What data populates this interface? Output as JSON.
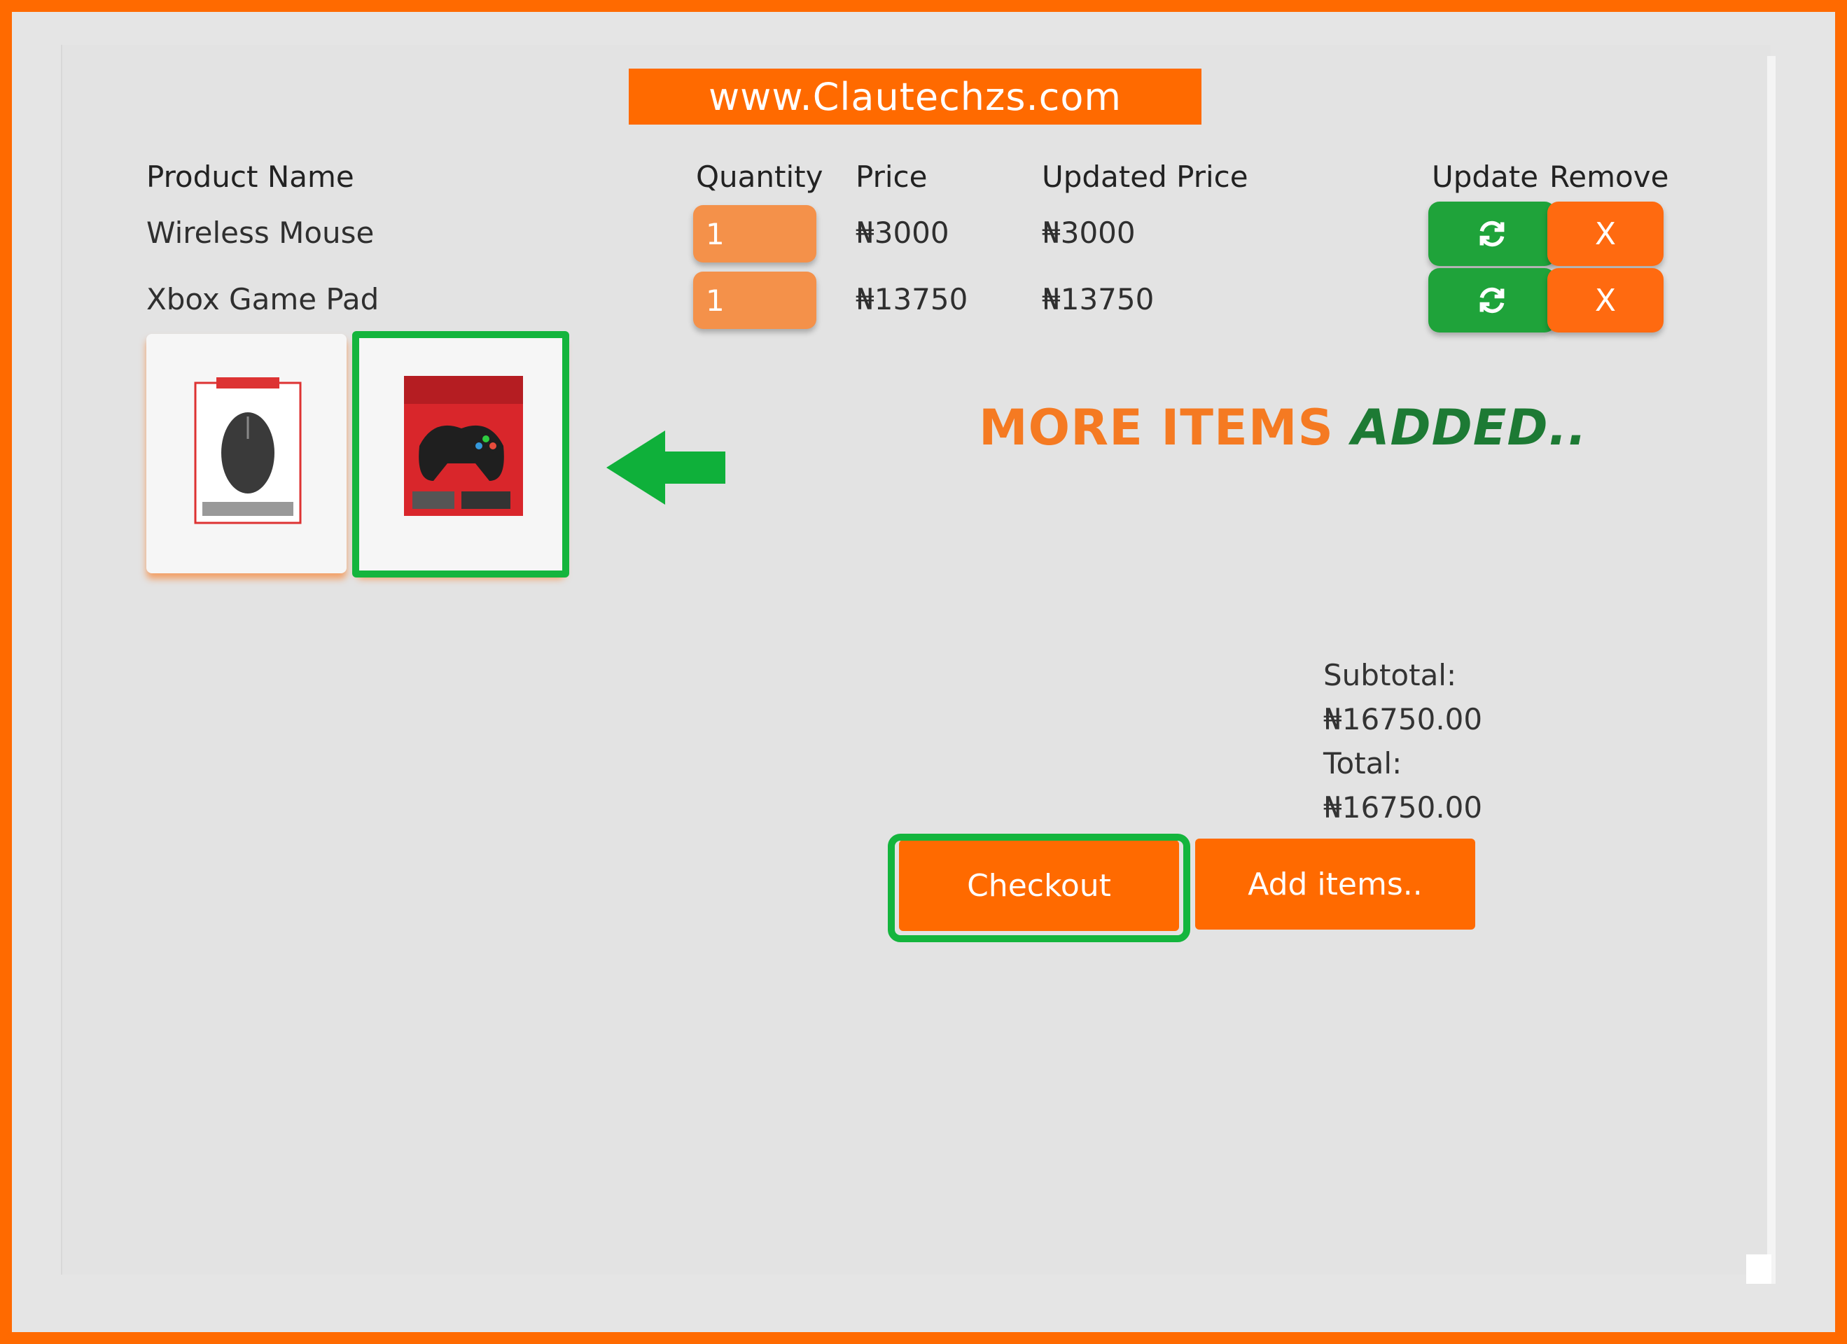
{
  "banner": {
    "text": "www.Clautechzs.com"
  },
  "table": {
    "headers": {
      "product": "Product Name",
      "quantity": "Quantity",
      "price": "Price",
      "updated_price": "Updated Price",
      "update": "Update",
      "remove": "Remove"
    },
    "rows": [
      {
        "name": "Wireless Mouse",
        "quantity": "1",
        "price": "₦3000",
        "updated_price": "₦3000",
        "update_icon": "refresh-icon",
        "remove_label": "X"
      },
      {
        "name": "Xbox Game Pad",
        "quantity": "1",
        "price": "₦13750",
        "updated_price": "₦13750",
        "update_icon": "refresh-icon",
        "remove_label": "X"
      }
    ]
  },
  "annotation": {
    "part1": "MORE ITEMS ",
    "part2": "ADDED..",
    "arrow_icon": "left-arrow-icon"
  },
  "summary": {
    "subtotal_label": "Subtotal:",
    "subtotal_value": "₦16750.00",
    "total_label": "Total:",
    "total_value": "₦16750.00"
  },
  "actions": {
    "checkout": "Checkout",
    "add_items": "Add items.."
  },
  "colors": {
    "brand_orange": "#ff6a00",
    "highlight_green": "#14b53d",
    "update_green": "#1fa33a"
  }
}
